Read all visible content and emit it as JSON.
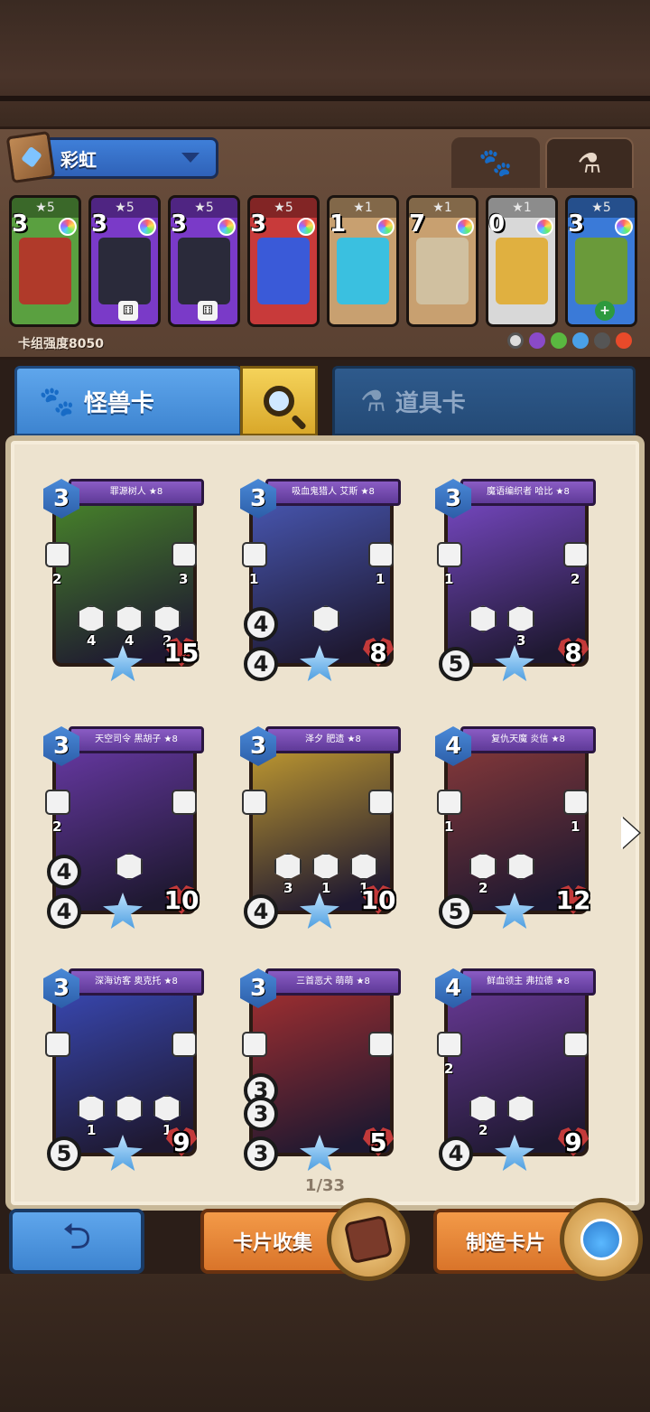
{
  "deck": {
    "name": "彩虹",
    "power_label": "卡组强度8050",
    "filter_tabs": [
      {
        "icon": "paw-icon"
      },
      {
        "icon": "flask-icon"
      }
    ],
    "cards": [
      {
        "cost": "3",
        "stars": "★5",
        "color": "#5aa040",
        "art": "#b03a2a",
        "badge": ""
      },
      {
        "cost": "3",
        "stars": "★5",
        "color": "#7a3ac8",
        "art": "#2a2a3a",
        "badge": "⚅"
      },
      {
        "cost": "3",
        "stars": "★5",
        "color": "#7a3ac8",
        "art": "#2a2a3a",
        "badge": "⚅"
      },
      {
        "cost": "3",
        "stars": "★5",
        "color": "#c83a3a",
        "art": "#3a5ad8",
        "badge": ""
      },
      {
        "cost": "1",
        "stars": "★1",
        "color": "#c8a070",
        "art": "#3ac0e0",
        "badge": ""
      },
      {
        "cost": "7",
        "stars": "★1",
        "color": "#c8a070",
        "art": "#d0c0a0",
        "badge": ""
      },
      {
        "cost": "0",
        "stars": "★1",
        "color": "#d8d8d8",
        "art": "#e0b040",
        "badge": ""
      },
      {
        "cost": "3",
        "stars": "★5",
        "color": "#3a7ad8",
        "art": "#6a9a3a",
        "badge": "+"
      }
    ]
  },
  "tabs": {
    "monster_label": "怪兽卡",
    "item_label": "道具卡"
  },
  "cards": [
    {
      "name": "罪源树人 ★8",
      "cost": "3",
      "atk": "",
      "spd": "",
      "hp": "15",
      "side_left": "2",
      "side_right": "3",
      "abilities": [
        "4",
        "4",
        "2"
      ],
      "frame": "#4a8a2a"
    },
    {
      "name": "吸血鬼猎人 艾斯 ★8",
      "cost": "3",
      "atk": "4",
      "spd": "4",
      "hp": "8",
      "side_left": "1",
      "side_right": "1",
      "abilities": [
        ""
      ],
      "frame": "#4a5ab8"
    },
    {
      "name": "魔语编织者 哈比 ★8",
      "cost": "3",
      "atk": "",
      "spd": "5",
      "hp": "8",
      "side_left": "1",
      "side_right": "2",
      "abilities": [
        "",
        "3"
      ],
      "frame": "#7a4ac8"
    },
    {
      "name": "天空司令 黑胡子 ★8",
      "cost": "3",
      "atk": "4",
      "spd": "4",
      "hp": "10",
      "side_left": "2",
      "side_right": "",
      "abilities": [
        ""
      ],
      "frame": "#6a3aa8"
    },
    {
      "name": "泽夕 肥遗 ★8",
      "cost": "3",
      "atk": "",
      "spd": "4",
      "hp": "10",
      "side_left": "",
      "side_right": "",
      "abilities": [
        "3",
        "1",
        "1"
      ],
      "frame": "#c8a030"
    },
    {
      "name": "复仇天魔 炎信 ★8",
      "cost": "4",
      "atk": "",
      "spd": "5",
      "hp": "12",
      "side_left": "1",
      "side_right": "1",
      "abilities": [
        "2",
        ""
      ],
      "frame": "#8a3a3a"
    },
    {
      "name": "深海访客 奥克托 ★8",
      "cost": "3",
      "atk": "",
      "spd": "5",
      "hp": "9",
      "side_left": "",
      "side_right": "",
      "abilities": [
        "1",
        "",
        "1"
      ],
      "frame": "#3a4ab8"
    },
    {
      "name": "三首恶犬 萌萌 ★8",
      "cost": "3",
      "atk": "3",
      "spd": "3",
      "hp": "5",
      "side_left": "",
      "side_right": "",
      "abilities": [],
      "extra_stat": "3",
      "frame": "#a83030"
    },
    {
      "name": "鲜血领主 弗拉德 ★8",
      "cost": "4",
      "atk": "",
      "spd": "4",
      "hp": "9",
      "side_left": "2",
      "side_right": "",
      "abilities": [
        "2",
        ""
      ],
      "frame": "#6a3a98"
    }
  ],
  "pager": "1/33",
  "buttons": {
    "back_icon": "back-arrow-icon",
    "collect_label": "卡片收集",
    "craft_label": "制造卡片"
  },
  "colors": {
    "accent_blue": "#3d84d0",
    "accent_orange": "#d9742a",
    "panel_bg": "#ede3cf"
  }
}
